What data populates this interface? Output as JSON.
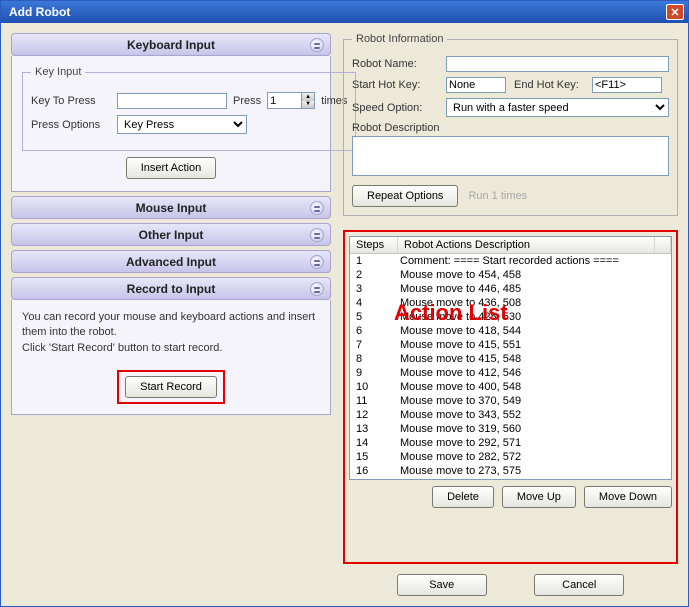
{
  "window": {
    "title": "Add Robot"
  },
  "accordion": {
    "keyboard": {
      "header": "Keyboard Input",
      "group_label": "Key Input",
      "key_to_press_label": "Key To Press",
      "key_to_press_value": "",
      "press_label": "Press",
      "press_count": "1",
      "times_label": "times",
      "press_options_label": "Press Options",
      "press_options_value": "Key Press",
      "insert_action_label": "Insert Action"
    },
    "mouse": {
      "header": "Mouse Input"
    },
    "other": {
      "header": "Other Input"
    },
    "advanced": {
      "header": "Advanced Input"
    },
    "record": {
      "header": "Record to Input",
      "text_line1": "You can record your mouse and keyboard actions and insert them into the robot.",
      "text_line2": "Click 'Start Record' button to start record.",
      "button": "Start Record"
    }
  },
  "info": {
    "legend": "Robot Information",
    "name_label": "Robot Name:",
    "name_value": "",
    "start_hotkey_label": "Start Hot Key:",
    "start_hotkey_value": "None",
    "end_hotkey_label": "End Hot Key:",
    "end_hotkey_value": "<F11>",
    "speed_label": "Speed Option:",
    "speed_value": "Run with a faster speed",
    "desc_label": "Robot Description",
    "desc_value": "",
    "repeat_button": "Repeat Options",
    "repeat_hint": "Run 1 times"
  },
  "actions": {
    "overlay": "Action List",
    "col_steps": "Steps",
    "col_desc": "Robot Actions Description",
    "rows": [
      {
        "n": "1",
        "d": "Comment: ==== Start recorded actions ===="
      },
      {
        "n": "2",
        "d": "Mouse move to 454, 458"
      },
      {
        "n": "3",
        "d": "Mouse move to 446, 485"
      },
      {
        "n": "4",
        "d": "Mouse move to 436, 508"
      },
      {
        "n": "5",
        "d": "Mouse move to 428, 530"
      },
      {
        "n": "6",
        "d": "Mouse move to 418, 544"
      },
      {
        "n": "7",
        "d": "Mouse move to 415, 551"
      },
      {
        "n": "8",
        "d": "Mouse move to 415, 548"
      },
      {
        "n": "9",
        "d": "Mouse move to 412, 546"
      },
      {
        "n": "10",
        "d": "Mouse move to 400, 548"
      },
      {
        "n": "11",
        "d": "Mouse move to 370, 549"
      },
      {
        "n": "12",
        "d": "Mouse move to 343, 552"
      },
      {
        "n": "13",
        "d": "Mouse move to 319, 560"
      },
      {
        "n": "14",
        "d": "Mouse move to 292, 571"
      },
      {
        "n": "15",
        "d": "Mouse move to 282, 572"
      },
      {
        "n": "16",
        "d": "Mouse move to 273, 575"
      }
    ],
    "delete": "Delete",
    "move_up": "Move Up",
    "move_down": "Move Down"
  },
  "buttons": {
    "save": "Save",
    "cancel": "Cancel"
  }
}
